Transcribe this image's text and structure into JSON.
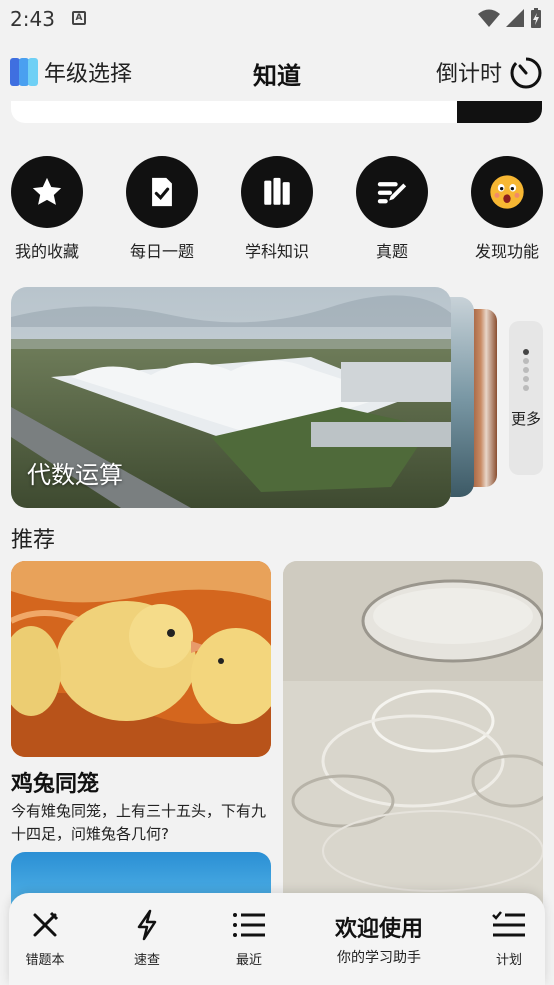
{
  "status": {
    "time": "2:43",
    "sim_letter": "A"
  },
  "header": {
    "grade_label": "年级选择",
    "title": "知道",
    "countdown_label": "倒计时"
  },
  "quick_actions": [
    {
      "label": "我的收藏",
      "icon": "star-icon"
    },
    {
      "label": "每日一题",
      "icon": "daily-check-icon"
    },
    {
      "label": "学科知识",
      "icon": "books-icon"
    },
    {
      "label": "真题",
      "icon": "exam-pen-icon"
    },
    {
      "label": "发现功能",
      "icon": "emoji-face-icon"
    }
  ],
  "banner": {
    "caption": "代数运算",
    "more_label": "更多"
  },
  "recommend": {
    "section_title": "推荐",
    "card1": {
      "title": "鸡兔同笼",
      "desc": "今有雉兔同笼，上有三十五头，下有九十四足，问雉兔各几何?"
    }
  },
  "bottom_nav": {
    "items": [
      {
        "label": "错题本",
        "icon": "cross-tools-icon"
      },
      {
        "label": "速查",
        "icon": "lightning-icon"
      },
      {
        "label": "最近",
        "icon": "list-icon"
      },
      {
        "label": "计划",
        "icon": "checklist-icon"
      }
    ],
    "welcome_title": "欢迎使用",
    "welcome_sub": "你的学习助手"
  }
}
